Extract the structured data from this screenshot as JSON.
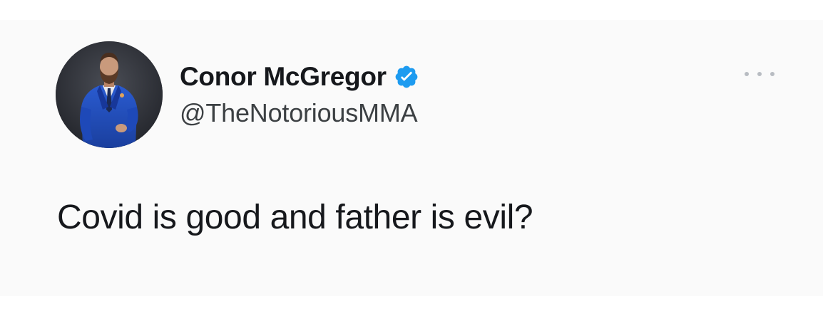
{
  "tweet": {
    "author": {
      "display_name": "Conor McGregor",
      "handle": "@TheNotoriousMMA",
      "verified": true,
      "avatar_icon": "profile-photo"
    },
    "text": "Covid is good and father is evil?",
    "more_icon": "more-options-icon"
  },
  "colors": {
    "verified_badge": "#1d9bf0",
    "text_primary": "#16181c",
    "text_secondary": "#3c4043",
    "card_background": "#fafafa"
  }
}
